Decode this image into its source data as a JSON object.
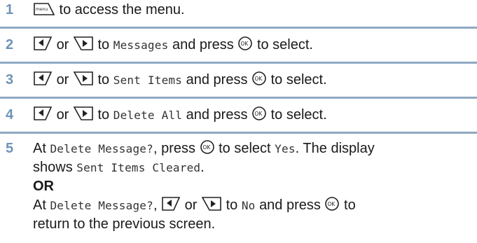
{
  "steps": [
    {
      "number": "1",
      "text_after_key": " to access the menu."
    },
    {
      "number": "2",
      "or": "or",
      "to": "to",
      "target": "Messages",
      "and_press": "and press",
      "to_select": "to select."
    },
    {
      "number": "3",
      "or": "or",
      "to": "to",
      "target": "Sent Items",
      "and_press": "and press",
      "to_select": "to select."
    },
    {
      "number": "4",
      "or": "or",
      "to": "to",
      "target": "Delete All",
      "and_press": "and press",
      "to_select": "to select."
    },
    {
      "number": "5",
      "line1_a": "At",
      "prompt": "Delete Message?",
      "line1_b": ", press",
      "line1_c": "to select",
      "yes": "Yes",
      "line1_d": ". The display",
      "line2_a": "shows",
      "cleared": "Sent Items Cleared",
      "line2_b": ".",
      "or_label": "OR",
      "line4_a": "At",
      "prompt2": "Delete Message?",
      "line4_b": ",",
      "line4_or": "or",
      "line4_to": "to",
      "no": "No",
      "line4_and": "and press",
      "line4_to2": "to",
      "line5": "return to the previous screen."
    }
  ],
  "icons": {
    "menu_key": "menu-key-icon",
    "left_key": "left-nav-key-icon",
    "right_key": "right-nav-key-icon",
    "ok_key": "ok-key-icon"
  },
  "colors": {
    "step_number": "#6f94b8",
    "divider": "#8fa8c3"
  }
}
